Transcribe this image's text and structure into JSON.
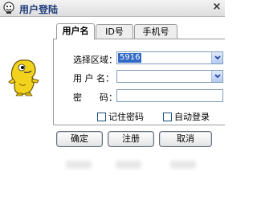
{
  "window": {
    "title": "用户登陆",
    "close_glyph": "×"
  },
  "tabs": [
    {
      "label": "用户名",
      "active": true
    },
    {
      "label": "ID号",
      "active": false
    },
    {
      "label": "手机号",
      "active": false
    }
  ],
  "form": {
    "region_label": "选择区域：",
    "region_value": "5916",
    "username_label": "用 户 名：",
    "username_value": "",
    "password_label": "密　　码：",
    "password_value": ""
  },
  "options": {
    "remember_password": {
      "label": "记住密码",
      "checked": false
    },
    "auto_login": {
      "label": "自动登录",
      "checked": false
    }
  },
  "buttons": {
    "ok": "确定",
    "register": "注册",
    "cancel": "取消"
  },
  "colors": {
    "selection": "#316ac5",
    "field_border": "#7f9db9",
    "title_text": "#1f3d7a"
  },
  "icons": {
    "title": "mascot-icon",
    "dropdown": "chevron-down-icon",
    "mascot": "yellow-dinosaur-mascot"
  }
}
